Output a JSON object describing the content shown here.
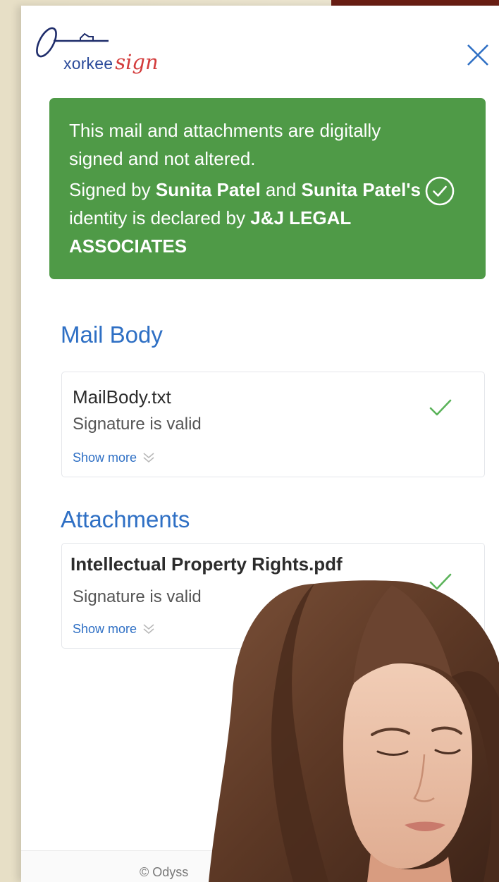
{
  "header": {
    "brand_main": "xorkee",
    "brand_sign": "sign",
    "close_icon": "close-icon"
  },
  "banner": {
    "line1": "This mail and attachments are digitally signed and not altered.",
    "signed_by_prefix": "Signed by ",
    "signer": "Sunita Patel",
    "and": " and ",
    "signer_possessive": "Sunita Patel's",
    "identity_text": " identity is declared by ",
    "declarer": "J&J LEGAL ASSOCIATES",
    "status_icon": "circle-check-icon",
    "color": "#4f9a47"
  },
  "mail_body": {
    "title": "Mail Body",
    "items": [
      {
        "file": "MailBody.txt",
        "status": "Signature is valid",
        "more": "Show more",
        "status_icon": "check-icon"
      }
    ]
  },
  "attachments": {
    "title": "Attachments",
    "items": [
      {
        "file": "Intellectual Property Rights.pdf",
        "status": "Signature is valid",
        "more": "Show more",
        "status_icon": "check-icon"
      }
    ]
  },
  "footer": {
    "text": "© Odyss"
  },
  "colors": {
    "accent_blue": "#2e6fc4",
    "valid_green": "#5bb35a",
    "brand_red": "#d33b3b",
    "brand_navy": "#2a4a9a"
  }
}
